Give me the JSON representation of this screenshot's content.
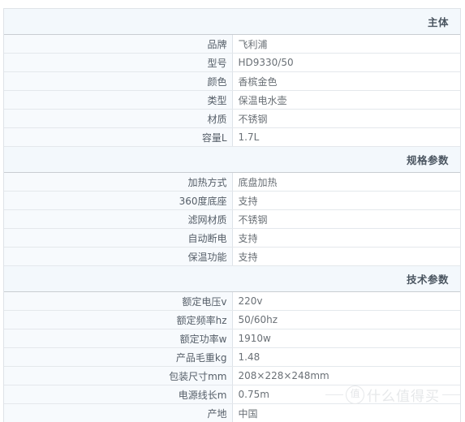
{
  "table": {
    "sections": [
      {
        "title": "主体",
        "rows": [
          {
            "label": "品牌",
            "value": "飞利浦"
          },
          {
            "label": "型号",
            "value": "HD9330/50"
          },
          {
            "label": "颜色",
            "value": "香槟金色"
          },
          {
            "label": "类型",
            "value": "保温电水壶"
          },
          {
            "label": "材质",
            "value": "不锈钢"
          },
          {
            "label": "容量L",
            "value": "1.7L"
          }
        ]
      },
      {
        "title": "规格参数",
        "rows": [
          {
            "label": "加热方式",
            "value": "底盘加热"
          },
          {
            "label": "360度底座",
            "value": "支持"
          },
          {
            "label": "滤网材质",
            "value": "不锈钢"
          },
          {
            "label": "自动断电",
            "value": "支持"
          },
          {
            "label": "保温功能",
            "value": "支持"
          }
        ]
      },
      {
        "title": "技术参数",
        "rows": [
          {
            "label": "额定电压v",
            "value": "220v"
          },
          {
            "label": "额定频率hz",
            "value": "50/60hz"
          },
          {
            "label": "额定功率w",
            "value": "1910w"
          },
          {
            "label": "产品毛重kg",
            "value": "1.48"
          },
          {
            "label": "包装尺寸mm",
            "value": "208×228×248mm"
          },
          {
            "label": "电源线长m",
            "value": "0.75m"
          },
          {
            "label": "产地",
            "value": "中国"
          }
        ]
      }
    ]
  },
  "watermark": {
    "badge": "值",
    "text": "什么值得买"
  },
  "colors": {
    "section_header_bg": "#f3f8fc",
    "label_bg": "#f7fafd",
    "value_bg": "#ffffff",
    "row_border": "#e4e8ec",
    "section_border": "#c9cdd2",
    "section_text": "#4a5560",
    "label_text": "#555e68",
    "value_text": "#6a7076",
    "watermark_text": "#e6e8ea"
  }
}
